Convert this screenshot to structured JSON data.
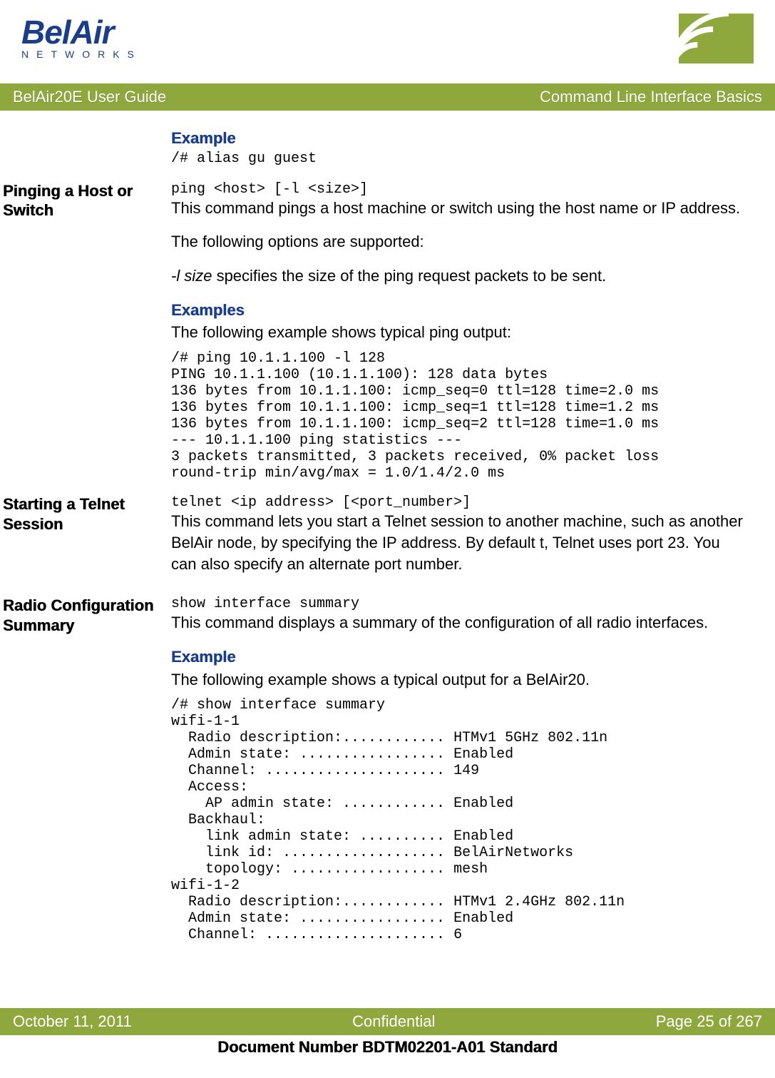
{
  "logo": {
    "top": "BelAir",
    "bottom": "NETWORKS"
  },
  "titlebar": {
    "left": "BelAir20E User Guide",
    "right": "Command Line Interface Basics"
  },
  "sec1": {
    "heading": "Example",
    "code": "/# alias gu guest"
  },
  "sec2": {
    "side": "Pinging a Host or Switch",
    "syntax": "ping <host> [-l <size>]",
    "p1": "This command pings a host machine or switch using the host name or IP address.",
    "p2": "The following options are supported:",
    "p3_pre": "-l size",
    "p3_post": " specifies the size of the ping request packets to be sent.",
    "ex_heading": "Examples",
    "ex_intro": "The following example shows typical ping output:",
    "ex_code": "/# ping 10.1.1.100 -l 128\nPING 10.1.1.100 (10.1.1.100): 128 data bytes\n136 bytes from 10.1.1.100: icmp_seq=0 ttl=128 time=2.0 ms\n136 bytes from 10.1.1.100: icmp_seq=1 ttl=128 time=1.2 ms\n136 bytes from 10.1.1.100: icmp_seq=2 ttl=128 time=1.0 ms\n--- 10.1.1.100 ping statistics ---\n3 packets transmitted, 3 packets received, 0% packet loss\nround-trip min/avg/max = 1.0/1.4/2.0 ms"
  },
  "sec3": {
    "side": "Starting a Telnet Session",
    "syntax": "telnet <ip address> [<port_number>]",
    "p1": "This command lets you start a Telnet session to another machine, such as another BelAir node, by specifying the IP address. By default t, Telnet uses port 23. You can also specify an alternate port number."
  },
  "sec4": {
    "side": "Radio Configuration Summary",
    "syntax": "show interface summary",
    "p1": "This command displays a summary of the configuration of all radio interfaces.",
    "ex_heading": "Example",
    "ex_intro": "The following example shows a typical output for a BelAir20.",
    "ex_code": "/# show interface summary\nwifi-1-1\n  Radio description:............ HTMv1 5GHz 802.11n\n  Admin state: ................. Enabled\n  Channel: ..................... 149\n  Access:\n    AP admin state: ............ Enabled\n  Backhaul:\n    link admin state: .......... Enabled\n    link id: ................... BelAirNetworks\n    topology: .................. mesh\nwifi-1-2\n  Radio description:............ HTMv1 2.4GHz 802.11n\n  Admin state: ................. Enabled\n  Channel: ..................... 6"
  },
  "footer": {
    "left": "October 11, 2011",
    "center": "Confidential",
    "right": "Page 25 of 267",
    "doc": "Document Number BDTM02201-A01 Standard"
  }
}
